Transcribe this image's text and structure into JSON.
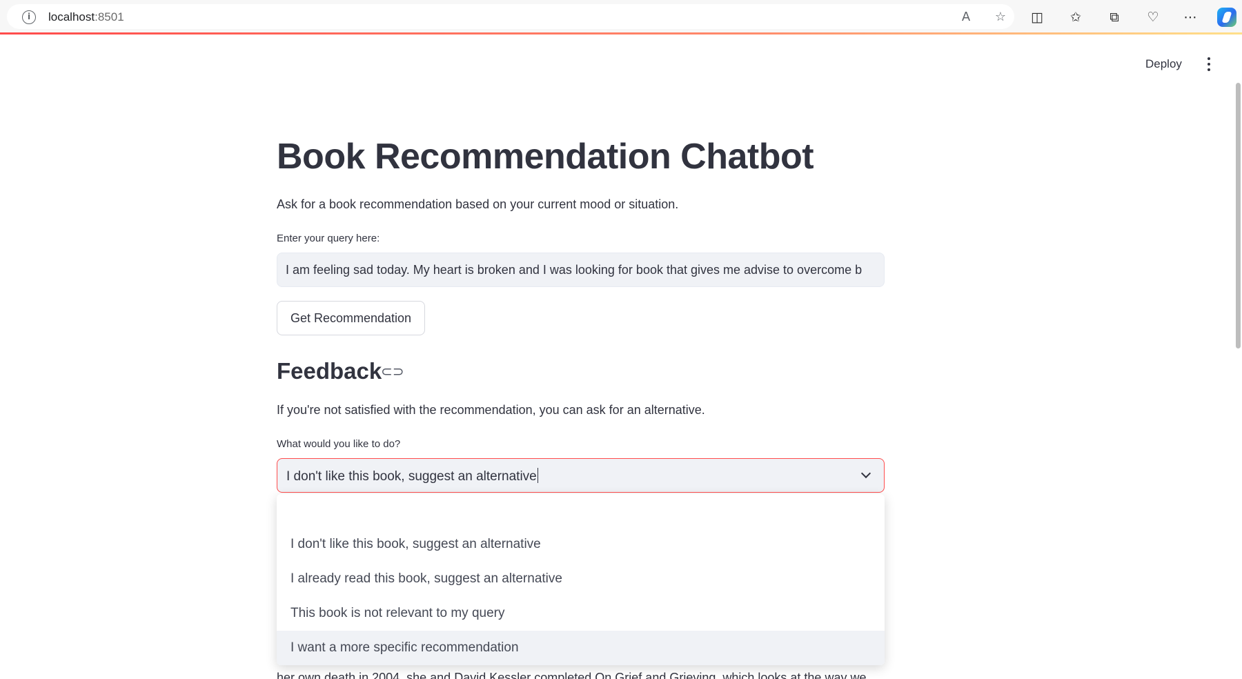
{
  "browser": {
    "url_host": "localhost",
    "url_port": ":8501",
    "icons": [
      "info-icon",
      "read-aloud-icon",
      "favorite-star-icon",
      "split-screen-icon",
      "favorites-icon",
      "collections-icon",
      "browser-essentials-icon",
      "more-icon",
      "copilot-icon"
    ]
  },
  "header": {
    "deploy_label": "Deploy"
  },
  "main": {
    "title": "Book Recommendation Chatbot",
    "subtitle": "Ask for a book recommendation based on your current mood or situation.",
    "query_label": "Enter your query here:",
    "query_value": "I am feeling sad today. My heart is broken and I was looking for book that gives me advise to overcome b",
    "get_button_label": "Get Recommendation",
    "feedback_heading": "Feedback",
    "feedback_desc": "If you're not satisfied with the recommendation, you can ask for an alternative.",
    "select_label": "What would you like to do?",
    "select_value": "I don't like this book, suggest an alternative",
    "options": [
      "I don't like this book, suggest an alternative",
      "I already read this book, suggest an alternative",
      "This book is not relevant to my query",
      "I want a more specific recommendation"
    ],
    "highlighted_option": "I want a more specific recommendation",
    "cut_text": "her own death in 2004, she and David Kessler completed On Grief and Grieving, which looks at the way we"
  },
  "colors": {
    "accent": "#ff4b4b",
    "input_bg": "#f0f2f6",
    "text": "#31333f"
  }
}
